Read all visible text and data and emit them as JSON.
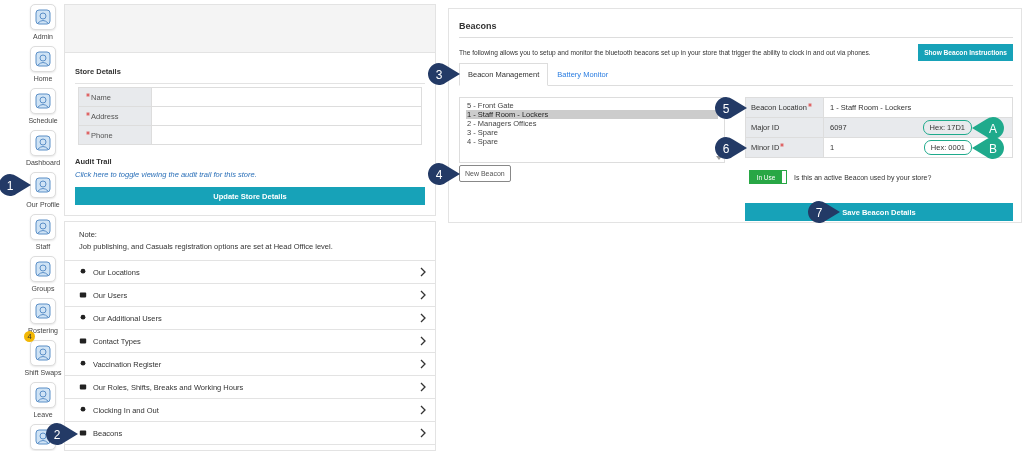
{
  "sidebar": {
    "items": [
      {
        "kind": "tile",
        "label": "Admin"
      },
      {
        "kind": "tile",
        "label": "Home"
      },
      {
        "kind": "tile",
        "label": "Schedule"
      },
      {
        "kind": "tile",
        "label": "Dashboard"
      },
      {
        "kind": "tile",
        "label": "Our Profile",
        "callout": {
          "label": "1",
          "kind": "step"
        }
      },
      {
        "kind": "tile",
        "label": "Staff"
      },
      {
        "kind": "tile",
        "label": "Groups"
      },
      {
        "kind": "tile",
        "label": "Rostering"
      },
      {
        "kind": "tile",
        "label": "Shift Swaps",
        "badge": "4"
      },
      {
        "kind": "tile",
        "label": "Leave"
      },
      {
        "kind": "partial"
      }
    ]
  },
  "store_details": {
    "title": "Store Details",
    "fields": [
      {
        "label": "Name",
        "required": true
      },
      {
        "label": "Address",
        "required": true
      },
      {
        "label": "Phone",
        "required": true
      }
    ],
    "audit_title": "Audit Trail",
    "audit_link": "Click here to toggle viewing the audit trail for this store.",
    "button": "Update Store Details"
  },
  "note": {
    "title": "Note:",
    "text": "Job publishing, and Casuals registration options are set at Head Office level."
  },
  "menu": [
    {
      "label": "Our Locations"
    },
    {
      "label": "Our Users"
    },
    {
      "label": "Our Additional Users"
    },
    {
      "label": "Contact Types"
    },
    {
      "label": "Vaccination Register"
    },
    {
      "label": "Our Roles, Shifts, Breaks and Working Hours"
    },
    {
      "label": "Clocking In and Out"
    },
    {
      "label": "Beacons",
      "callout": {
        "label": "2",
        "kind": "step"
      }
    }
  ],
  "beacons": {
    "title": "Beacons",
    "description": "The following allows you to setup and monitor the bluetooth beacons set up in your store that trigger the ability to clock in and out via phones.",
    "instructions_button": "Show Beacon Instructions",
    "tabs": [
      {
        "label": "Beacon Management",
        "selected": true,
        "callout": {
          "label": "3",
          "kind": "step"
        }
      },
      {
        "label": "Battery Monitor",
        "selected": false
      }
    ],
    "list": [
      {
        "label": "5 - Front Gate",
        "selected": false
      },
      {
        "label": "1 - Staff Room - Lockers",
        "selected": true
      },
      {
        "label": "2 - Managers Offices",
        "selected": false
      },
      {
        "label": "3 - Spare",
        "selected": false
      },
      {
        "label": "4 - Spare",
        "selected": false
      }
    ],
    "new_button": {
      "label": "New Beacon",
      "callout": {
        "label": "4",
        "kind": "step"
      }
    },
    "details": [
      {
        "label": "Beacon Location",
        "required": true,
        "value": "1 - Staff Room - Lockers",
        "callout": {
          "label": "5",
          "kind": "step"
        }
      },
      {
        "label": "Major ID",
        "required": false,
        "value": "6097",
        "hex": "Hex: 17D1",
        "hex_callout": {
          "label": "A",
          "kind": "letter"
        }
      },
      {
        "label": "Minor ID",
        "required": true,
        "value": "1",
        "hex": "Hex: 0001",
        "callout": {
          "label": "6",
          "kind": "step"
        },
        "hex_callout": {
          "label": "B",
          "kind": "letter"
        }
      }
    ],
    "toggle": {
      "label": "In Use",
      "on": true,
      "question": "Is this an active Beacon used by your store?"
    },
    "save_button": {
      "label": "Save Beacon Details",
      "callout": {
        "label": "7",
        "kind": "step"
      }
    }
  }
}
